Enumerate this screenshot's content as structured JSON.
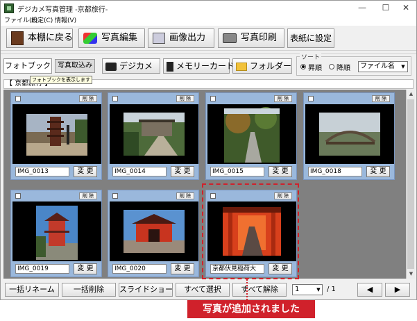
{
  "window": {
    "title": "デジカメ写真管理 -京都旅行-",
    "controls": {
      "minimize": "—",
      "maximize": "☐",
      "close": "✕"
    }
  },
  "menu": [
    "ファイル(F)",
    "設定(C)",
    "情報(V)"
  ],
  "toolbar": {
    "back_label": "本棚に戻る",
    "edit_label": "写真編集",
    "output_label": "画像出力",
    "print_label": "写真印刷",
    "cover_label": "表紙に設定"
  },
  "subbar": {
    "photobook_tab": "フォトブック",
    "import_label": "写真取込み",
    "digicam_label": "デジカメ",
    "memorycard_label": "メモリーカード",
    "folder_label": "フォルダー",
    "sort": {
      "legend": "ソート",
      "ascending": "昇順",
      "descending": "降順",
      "selected": "ファイル名",
      "arrow": "▼"
    }
  },
  "album": {
    "title": "【 京都旅行 】",
    "tooltip": "フォトブックを表示します"
  },
  "photos": [
    {
      "name": "IMG_0013",
      "delete_label": "削 除",
      "change_label": "変 更"
    },
    {
      "name": "IMG_0014",
      "delete_label": "削 除",
      "change_label": "変 更"
    },
    {
      "name": "IMG_0015",
      "delete_label": "削 除",
      "change_label": "変 更"
    },
    {
      "name": "IMG_0018",
      "delete_label": "削 除",
      "change_label": "変 更"
    },
    {
      "name": "IMG_0019",
      "delete_label": "削 除",
      "change_label": "変 更"
    },
    {
      "name": "IMG_0020",
      "delete_label": "削 除",
      "change_label": "変 更"
    },
    {
      "name": "京都伏見稲荷大",
      "delete_label": "削 除",
      "change_label": "変 更"
    }
  ],
  "bottombar": {
    "bulk_rename": "一括リネーム",
    "bulk_delete": "一括削除",
    "slideshow": "スライドショー",
    "select_all": "すべて選択",
    "deselect_all": "すべて解除",
    "page_current": "1",
    "page_total": "/ 1",
    "prev": "◀",
    "next": "▶"
  },
  "callout": "写真が追加されました",
  "colors": {
    "card_bg": "#9ab8dc",
    "grid_bg": "#808080",
    "highlight": "#d0212b"
  }
}
